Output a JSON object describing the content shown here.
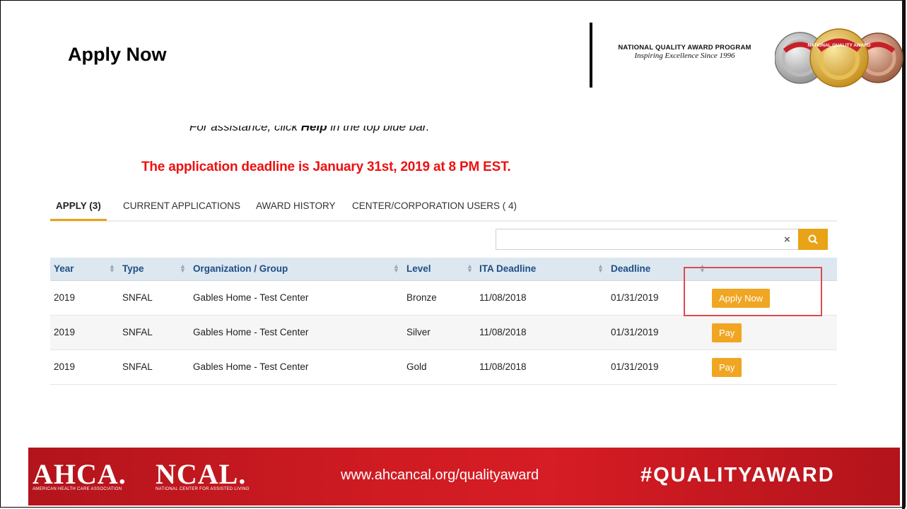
{
  "slide": {
    "title": "Apply Now",
    "program_name": "NATIONAL QUALITY AWARD PROGRAM",
    "program_tagline": "Inspiring Excellence Since 1996",
    "medal_text": "NATIONAL QUALITY AWARD"
  },
  "notice": {
    "assistance_prefix": "For assistance, click ",
    "assistance_help": "Help",
    "assistance_suffix": " in the top blue bar.",
    "deadline": "The application deadline is January 31st, 2019 at 8 PM EST."
  },
  "tabs": [
    {
      "label": "APPLY (3)",
      "active": true
    },
    {
      "label": "CURRENT APPLICATIONS",
      "active": false
    },
    {
      "label": "AWARD HISTORY",
      "active": false
    },
    {
      "label": "CENTER/CORPORATION USERS ( 4)",
      "active": false
    }
  ],
  "search": {
    "value": "",
    "placeholder": "",
    "clear_glyph": "×"
  },
  "table": {
    "headers": [
      "Year",
      "Type",
      "Organization / Group",
      "Level",
      "ITA Deadline",
      "Deadline",
      ""
    ],
    "rows": [
      {
        "year": "2019",
        "type": "SNFAL",
        "org": "Gables Home - Test Center",
        "level": "Bronze",
        "ita": "11/08/2018",
        "deadline": "01/31/2019",
        "action": "Apply Now"
      },
      {
        "year": "2019",
        "type": "SNFAL",
        "org": "Gables Home - Test Center",
        "level": "Silver",
        "ita": "11/08/2018",
        "deadline": "01/31/2019",
        "action": "Pay"
      },
      {
        "year": "2019",
        "type": "SNFAL",
        "org": "Gables Home - Test Center",
        "level": "Gold",
        "ita": "11/08/2018",
        "deadline": "01/31/2019",
        "action": "Pay"
      }
    ]
  },
  "footer": {
    "ahca": "AHCA.",
    "ahca_sub": "AMERICAN HEALTH CARE ASSOCIATION",
    "ncal": "NCAL.",
    "ncal_sub": "NATIONAL CENTER FOR ASSISTED LIVING",
    "url": "www.ahcancal.org/qualityaward",
    "hashtag": "#QUALITYAWARD"
  },
  "colors": {
    "accent": "#e8a317",
    "deadline_red": "#ee1111",
    "highlight_red": "#e0494d",
    "header_blue": "#1e4e86",
    "footer_red": "#d61c24"
  },
  "icons": {
    "search": "search-icon",
    "clear": "clear-icon",
    "sort": "sort-icon"
  }
}
